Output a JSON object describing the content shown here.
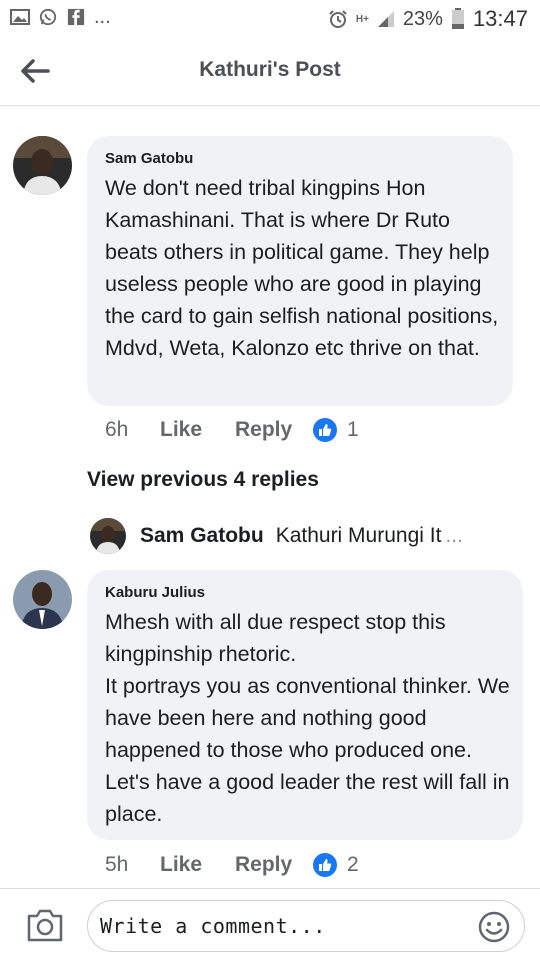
{
  "status_bar": {
    "battery_percent": "23%",
    "time": "13:47",
    "network_label": "H+",
    "more": "..."
  },
  "header": {
    "title": "Kathuri's Post"
  },
  "comments": [
    {
      "author": "Sam Gatobu",
      "text": "We don't need tribal kingpins Hon Kamashinani. That is where Dr Ruto beats others in political game. They help useless people who are good in playing the card to gain selfish national positions, Mdvd, Weta, Kalonzo etc thrive on that.",
      "time": "6h",
      "like_label": "Like",
      "reply_label": "Reply",
      "reaction_count": "1"
    },
    {
      "author": "Kaburu Julius",
      "text": "Mhesh with all due respect stop this kingpinship rhetoric.\nIt portrays you as conventional thinker. We have been here and nothing good happened to those who produced one. Let's have a good leader the rest will fall in place.",
      "time": "5h",
      "like_label": "Like",
      "reply_label": "Reply",
      "reaction_count": "2"
    }
  ],
  "view_previous_replies": "View previous 4 replies",
  "reply_preview": {
    "author": "Sam Gatobu",
    "snippet": "Kathuri Murungi  It",
    "ellipsis": "..."
  },
  "composer": {
    "placeholder": "Write a comment..."
  },
  "colors": {
    "bubble": "#f0f2f5",
    "like_blue": "#1877f2",
    "meta_gray": "#65676b"
  },
  "icons": [
    "gallery-icon",
    "whatsapp-icon",
    "facebook-icon",
    "alarm-icon",
    "signal-icon",
    "battery-icon",
    "back-arrow-icon",
    "thumbs-up-icon",
    "camera-icon",
    "emoji-icon"
  ]
}
